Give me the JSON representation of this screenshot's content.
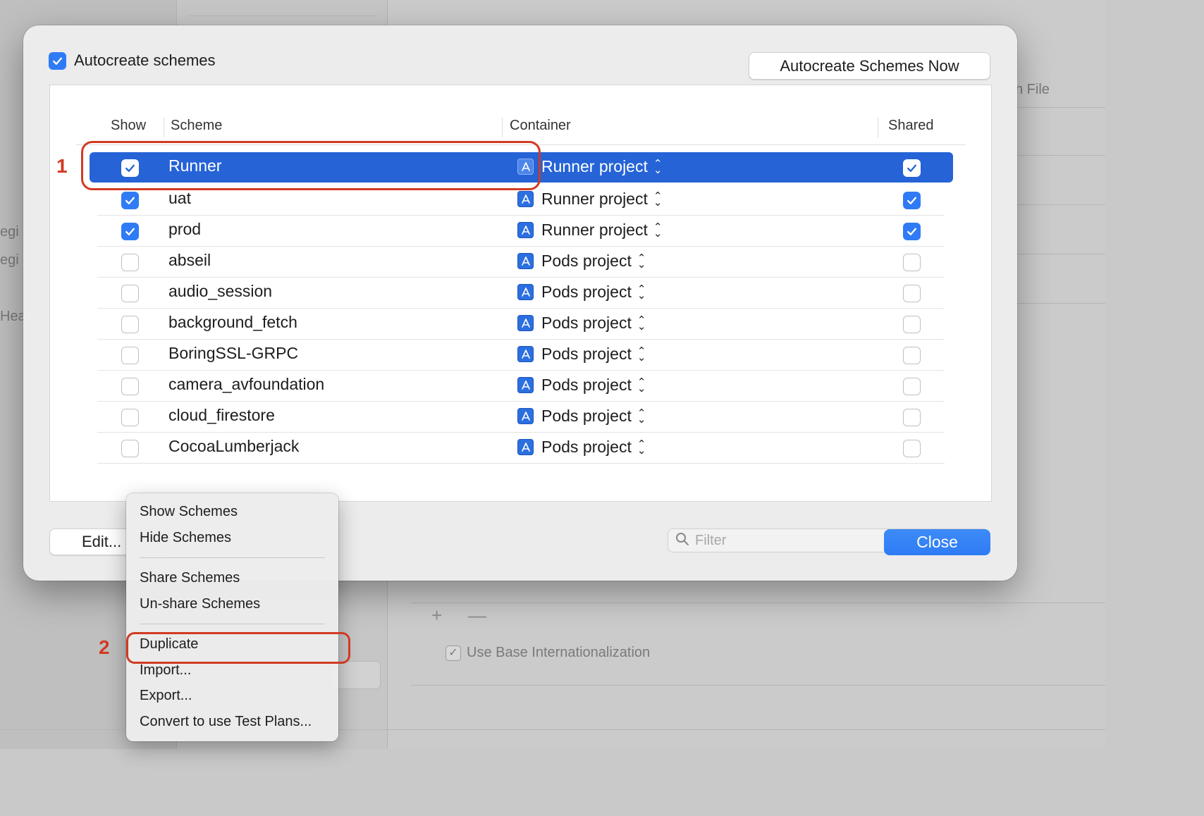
{
  "background": {
    "partial_texts": [
      "egi",
      "egi",
      "Hea",
      "n File"
    ],
    "base_internationalization_label": "Use Base Internationalization",
    "add_symbol": "+",
    "remove_symbol": "—"
  },
  "dialog": {
    "autocreate_label": "Autocreate schemes",
    "autocreate_checked": true,
    "autocreate_now_button": "Autocreate Schemes Now",
    "columns": {
      "show": "Show",
      "scheme": "Scheme",
      "container": "Container",
      "shared": "Shared"
    },
    "rows": [
      {
        "name": "Runner",
        "container": "Runner project",
        "show": true,
        "shared": true,
        "selected": true
      },
      {
        "name": "uat",
        "container": "Runner project",
        "show": true,
        "shared": true
      },
      {
        "name": "prod",
        "container": "Runner project",
        "show": true,
        "shared": true
      },
      {
        "name": "abseil",
        "container": "Pods project",
        "show": false,
        "shared": false
      },
      {
        "name": "audio_session",
        "container": "Pods project",
        "show": false,
        "shared": false
      },
      {
        "name": "background_fetch",
        "container": "Pods project",
        "show": false,
        "shared": false
      },
      {
        "name": "BoringSSL-GRPC",
        "container": "Pods project",
        "show": false,
        "shared": false
      },
      {
        "name": "camera_avfoundation",
        "container": "Pods project",
        "show": false,
        "shared": false
      },
      {
        "name": "cloud_firestore",
        "container": "Pods project",
        "show": false,
        "shared": false
      },
      {
        "name": "CocoaLumberjack",
        "container": "Pods project",
        "show": false,
        "shared": false
      }
    ],
    "toolbar": {
      "add": "+",
      "remove": "—",
      "more": "···"
    },
    "filter_placeholder": "Filter",
    "edit_button": "Edit...",
    "close_button": "Close"
  },
  "context_menu": {
    "items": [
      "Show Schemes",
      "Hide Schemes",
      "Share Schemes",
      "Un-share Schemes",
      "Duplicate",
      "Import...",
      "Export...",
      "Convert to use Test Plans..."
    ]
  },
  "annotations": {
    "step1": "1",
    "step2": "2",
    "color": "#d13a23"
  },
  "colors": {
    "accent": "#2f7bf5",
    "selection": "#2563d6"
  }
}
